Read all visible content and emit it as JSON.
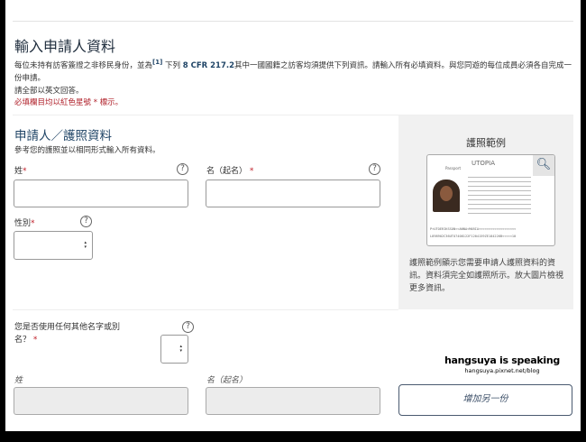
{
  "header": {
    "title": "輸入申請人資料",
    "description_pre": "每位未持有訪客簽證之非移民身份，並為",
    "footnote": "[1]",
    "description_mid": " 下列 ",
    "regulation": "8 CFR 217.2",
    "description_post": "其中一國國籍之訪客均須提供下列資訊。請輸入所有必填資料。與您同遊的每位成員必須各自完成一份申請。",
    "english_note": "請全部以英文回答。",
    "required_note": "必填欄目均以紅色星號 * 標示。"
  },
  "section": {
    "title": "申請人／護照資料",
    "subtitle": "參考您的護照並以相同形式輸入所有資料。",
    "surname_label": "姓",
    "given_label": "名（起名）",
    "gender_label": "性別",
    "required_mark": "*",
    "alias_question": "您是否使用任何其他名字或別名？",
    "help_icon": "?"
  },
  "passport_panel": {
    "title": "護照範例",
    "card_country": "UTOPIA",
    "card_type": "Passport",
    "mrz1": "P<UTOERIKSSON<<ANNA<MARIA<<<<<<<<<<<<<<<<<<<",
    "mrz2": "L898902C36UTO7408122F1204159ZE184226B<<<<<10",
    "description": "護照範例顯示您需要申請人護照資料的資訊。資料須完全如護照所示。放大圖片檢視更多資訊。"
  },
  "alias": {
    "surname_label": "姓",
    "given_label": "名（起名）",
    "add_button": "增加另一份"
  },
  "watermark": {
    "line1": "hangsuya is speaking",
    "line2": "hangsuya.pixnet.net/blog"
  },
  "colors": {
    "accent": "#1f4466",
    "required": "#c0202a",
    "panel": "#f1f1f1"
  }
}
